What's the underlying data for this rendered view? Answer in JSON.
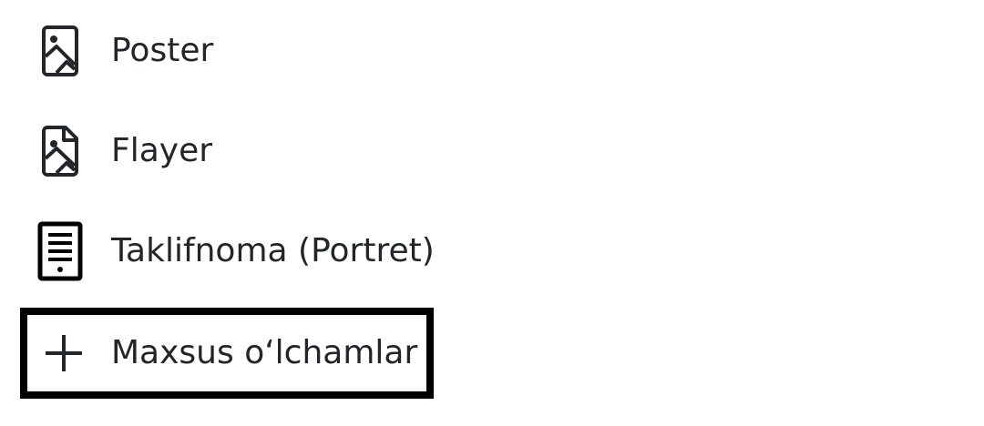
{
  "menu": {
    "items": [
      {
        "label": "Poster",
        "icon": "poster-image-icon"
      },
      {
        "label": "Flayer",
        "icon": "flyer-image-icon"
      },
      {
        "label": "Taklifnoma (Portret)",
        "icon": "document-lines-icon"
      },
      {
        "label": "Maxsus o‘lchamlar",
        "icon": "plus-icon"
      }
    ],
    "highlight_color": "#000000",
    "text_color": "#22262b"
  }
}
